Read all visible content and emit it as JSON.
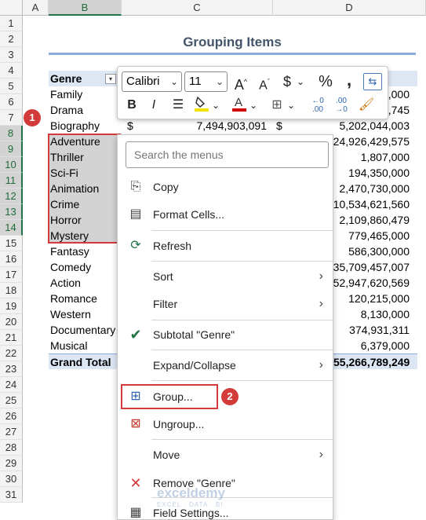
{
  "columns": [
    "A",
    "B",
    "C",
    "D"
  ],
  "rows": [
    "1",
    "2",
    "3",
    "4",
    "5",
    "6",
    "7",
    "8",
    "9",
    "10",
    "11",
    "12",
    "13",
    "14",
    "15",
    "16",
    "17",
    "18",
    "19",
    "20",
    "21",
    "22",
    "23",
    "24",
    "25",
    "26",
    "27",
    "28",
    "29",
    "30",
    "31"
  ],
  "title": "Grouping Items",
  "table": {
    "header": "Genre",
    "header_dropdown_icon": "filter-dropdown-icon",
    "genres": [
      "Family",
      "Drama",
      "Biography",
      "Adventure",
      "Thriller",
      "Sci-Fi",
      "Animation",
      "Crime",
      "Horror",
      "Mystery",
      "Fantasy",
      "Comedy",
      "Action",
      "Romance",
      "Western",
      "Documentary",
      "Musical"
    ],
    "grand_total_label": "Grand Total",
    "col_c_biography": "7,494,903,091",
    "col_d_values": [
      ",000",
      ",745",
      "5,202,044,003",
      "24,926,429,575",
      "1,807,000",
      "194,350,000",
      "2,470,730,000",
      "10,534,621,560",
      "2,109,860,479",
      "779,465,000",
      "586,300,000",
      "35,709,457,007",
      "52,947,620,569",
      "120,215,000",
      "8,130,000",
      "374,931,311",
      "6,379,000"
    ],
    "grand_total_d": "55,266,789,249",
    "currency": "$"
  },
  "badges": [
    "1",
    "2"
  ],
  "mini_toolbar": {
    "font_name": "Calibri",
    "font_size": "11",
    "bold": "B",
    "italic": "I",
    "accent_fill": "#f5e100",
    "accent_font": "#d00000"
  },
  "context_menu": {
    "search_placeholder": "Search the menus",
    "items": [
      {
        "label": "Copy",
        "icon": "copy-icon"
      },
      {
        "label": "Format Cells...",
        "icon": "format-cells-icon"
      },
      {
        "label": "Refresh",
        "icon": "refresh-icon"
      },
      {
        "label": "Sort",
        "icon": "",
        "submenu": true
      },
      {
        "label": "Filter",
        "icon": "",
        "submenu": true
      },
      {
        "label": "Subtotal \"Genre\"",
        "icon": "checkmark-icon"
      },
      {
        "label": "Expand/Collapse",
        "icon": "",
        "submenu": true
      },
      {
        "label": "Group...",
        "icon": "group-icon"
      },
      {
        "label": "Ungroup...",
        "icon": "ungroup-icon"
      },
      {
        "label": "Move",
        "icon": "",
        "submenu": true
      },
      {
        "label": "Remove \"Genre\"",
        "icon": "remove-x-icon"
      },
      {
        "label": "Field Settings...",
        "icon": "field-settings-icon"
      }
    ]
  },
  "watermark": {
    "name": "exceldemy",
    "tagline": "EXCEL · DATA · BI"
  },
  "colors": {
    "selection_outline": "#d33b3b",
    "header_fill": "#dde7f4",
    "title": "#44546a",
    "check": "#217346"
  }
}
